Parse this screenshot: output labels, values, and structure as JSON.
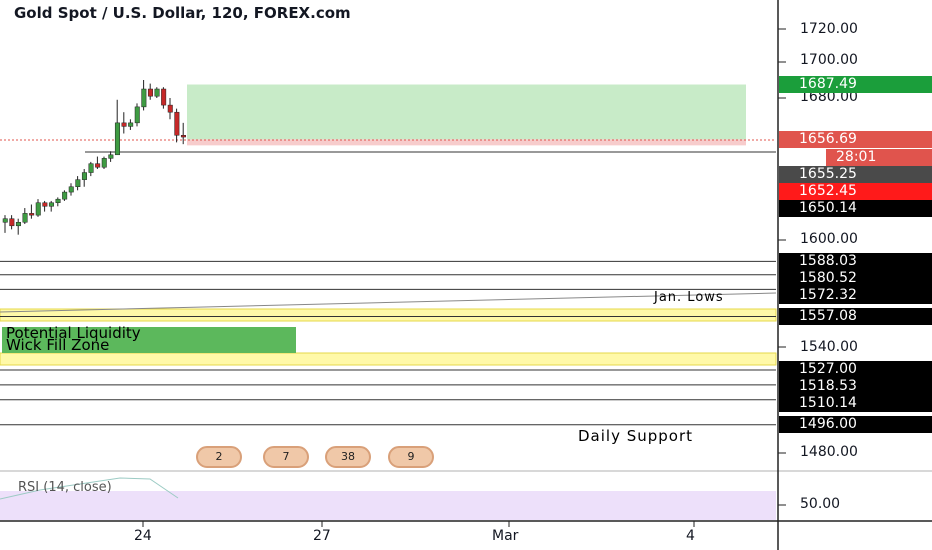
{
  "title": "Gold Spot / U.S. Dollar, 120, FOREX.com",
  "colors": {
    "up": "#26a69a",
    "down": "#ef5350",
    "bull_candle": "#3e9b42",
    "bear_candle": "#c62828",
    "target_zone": "#c8ebc8",
    "stop_zone": "#f7cccc",
    "yellow_zone": "#fff9a8",
    "zone_label": "#5cb85c",
    "rsi_band": "#ede0fa"
  },
  "price_axis": {
    "ticks": [
      "1720.00",
      "1700.00",
      "1680.00",
      "1600.00",
      "1540.00",
      "1480.00",
      "50.00"
    ]
  },
  "price_labels": {
    "target": "1687.49",
    "current": "1656.69",
    "countdown": "28:01",
    "p1": "1655.25",
    "p2": "1652.45",
    "p3": "1650.14",
    "l1": "1588.03",
    "l2": "1580.52",
    "l3": "1572.32",
    "l4": "1557.08",
    "l5": "1527.00",
    "l6": "1518.53",
    "l7": "1510.14",
    "l8": "1496.00"
  },
  "x_axis": {
    "ticks": [
      "24",
      "27",
      "Mar",
      "4"
    ]
  },
  "annotations": {
    "jan_lows": "Jan. Lows",
    "zone_line1": "Potential Liquidity",
    "zone_line2": "Wick Fill Zone",
    "daily_support": "Daily Support"
  },
  "events": [
    "2",
    "7",
    "38",
    "9"
  ],
  "rsi_label": "RSI (14, close)",
  "chart_data": {
    "type": "candlestick",
    "title": "Gold Spot / U.S. Dollar, 120, FOREX.com",
    "ylim": [
      1462,
      1730
    ],
    "candles": [
      {
        "o": 1610,
        "h": 1614,
        "l": 1604,
        "c": 1612
      },
      {
        "o": 1612,
        "h": 1614,
        "l": 1606,
        "c": 1608
      },
      {
        "o": 1608,
        "h": 1612,
        "l": 1603,
        "c": 1610
      },
      {
        "o": 1610,
        "h": 1618,
        "l": 1609,
        "c": 1615
      },
      {
        "o": 1615,
        "h": 1620,
        "l": 1612,
        "c": 1614
      },
      {
        "o": 1614,
        "h": 1623,
        "l": 1613,
        "c": 1621
      },
      {
        "o": 1621,
        "h": 1622,
        "l": 1616,
        "c": 1619
      },
      {
        "o": 1619,
        "h": 1622,
        "l": 1616,
        "c": 1621
      },
      {
        "o": 1621,
        "h": 1624,
        "l": 1619,
        "c": 1623
      },
      {
        "o": 1623,
        "h": 1628,
        "l": 1622,
        "c": 1627
      },
      {
        "o": 1627,
        "h": 1632,
        "l": 1625,
        "c": 1630
      },
      {
        "o": 1630,
        "h": 1636,
        "l": 1628,
        "c": 1634
      },
      {
        "o": 1634,
        "h": 1640,
        "l": 1630,
        "c": 1638
      },
      {
        "o": 1638,
        "h": 1644,
        "l": 1636,
        "c": 1643
      },
      {
        "o": 1643,
        "h": 1647,
        "l": 1640,
        "c": 1641
      },
      {
        "o": 1641,
        "h": 1647,
        "l": 1640,
        "c": 1646
      },
      {
        "o": 1646,
        "h": 1650,
        "l": 1644,
        "c": 1648
      },
      {
        "o": 1648,
        "h": 1679,
        "l": 1648,
        "c": 1666
      },
      {
        "o": 1666,
        "h": 1672,
        "l": 1660,
        "c": 1664
      },
      {
        "o": 1664,
        "h": 1668,
        "l": 1662,
        "c": 1666
      },
      {
        "o": 1666,
        "h": 1677,
        "l": 1664,
        "c": 1675
      },
      {
        "o": 1675,
        "h": 1690,
        "l": 1673,
        "c": 1685
      },
      {
        "o": 1685,
        "h": 1688,
        "l": 1679,
        "c": 1681
      },
      {
        "o": 1681,
        "h": 1686,
        "l": 1680,
        "c": 1685
      },
      {
        "o": 1685,
        "h": 1686,
        "l": 1674,
        "c": 1676
      },
      {
        "o": 1676,
        "h": 1680,
        "l": 1668,
        "c": 1672
      },
      {
        "o": 1672,
        "h": 1674,
        "l": 1655,
        "c": 1659
      },
      {
        "o": 1659,
        "h": 1666,
        "l": 1654,
        "c": 1658
      }
    ],
    "horizontal_levels": [
      1650.14,
      1588.03,
      1580.52,
      1572.32,
      1557.08,
      1527.0,
      1518.53,
      1510.14,
      1496.0
    ],
    "target_zone": [
      1656.69,
      1687.49
    ],
    "rsi_reference": 50.0
  }
}
